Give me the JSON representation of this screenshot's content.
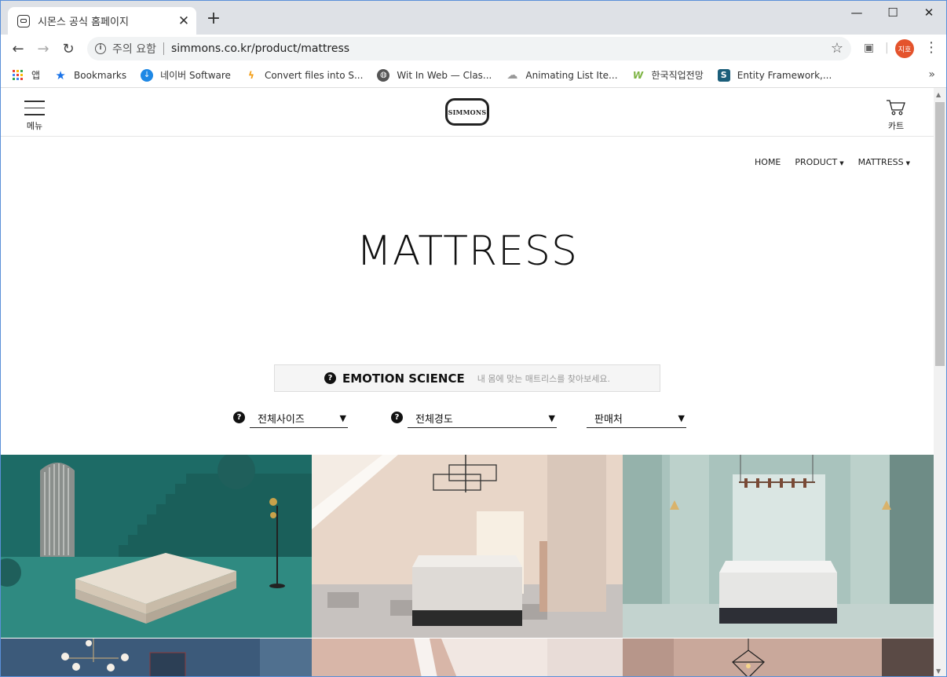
{
  "browser": {
    "tab_title": "시몬스 공식 홈페이지",
    "new_tab": "+",
    "security_text": "주의 요함",
    "url": "simmons.co.kr/product/mattress",
    "profile_initials": "지호"
  },
  "bookmarks": [
    {
      "label": "앱",
      "icon": "apps-grid-icon"
    },
    {
      "label": "Bookmarks",
      "icon": "star-icon",
      "color": "#1a73e8"
    },
    {
      "label": "네이버 Software",
      "icon": "download-icon",
      "color": "#1e88e5"
    },
    {
      "label": "Convert files into S...",
      "icon": "s-lightning-icon",
      "color": "#f39c12"
    },
    {
      "label": "Wit In Web — Clas...",
      "icon": "globe-icon",
      "color": "#555555"
    },
    {
      "label": "Animating List Ite...",
      "icon": "cloud-icon",
      "color": "#999999"
    },
    {
      "label": "한국직업전망",
      "icon": "w-logo-icon",
      "color": "#7cb342"
    },
    {
      "label": "Entity Framework,...",
      "icon": "s-box-icon",
      "color": "#1b5e7a"
    }
  ],
  "site": {
    "menu_label": "메뉴",
    "logo_text": "SIMMONS",
    "cart_label": "카트",
    "breadcrumb": [
      "HOME",
      "PRODUCT",
      "MATTRESS"
    ],
    "page_title": "MATTRESS",
    "emotion_title": "EMOTION SCIENCE",
    "emotion_sub": "내 몸에 맞는 매트리스를 찾아보세요.",
    "filters": {
      "size": "전체사이즈",
      "firmness": "전체경도",
      "store": "판매처"
    }
  },
  "colors": {
    "tile1_bg": "#1d6b66",
    "tile2_bg": "#e8d6c8",
    "tile3_bg": "#a9c3bd",
    "avatar": "#e4532c"
  }
}
